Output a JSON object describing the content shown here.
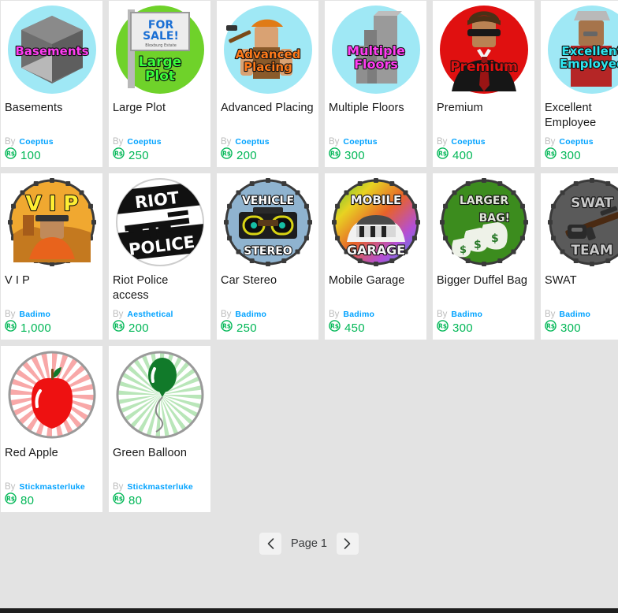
{
  "page": {
    "background_color": "#e3e3e3",
    "card_background": "#ffffff",
    "link_color": "#00a2ff",
    "price_color": "#02b757",
    "title_color": "#191919",
    "by_label": "By"
  },
  "items": [
    {
      "name": "Basements",
      "creator": "Coeptus",
      "price": "100",
      "thumb": {
        "id": "basements-thumbnail",
        "bg": "#9fe8f5",
        "art_text": "Basements",
        "art_color": "#ff3df2"
      }
    },
    {
      "name": "Large Plot",
      "creator": "Coeptus",
      "price": "250",
      "thumb": {
        "id": "large-plot-thumbnail",
        "bg": "#6fd22a",
        "art_text": "Large Plot",
        "art_color": "#3bff3b"
      }
    },
    {
      "name": "Advanced Placing",
      "creator": "Coeptus",
      "price": "200",
      "thumb": {
        "id": "advanced-placing-thumbnail",
        "bg": "#9fe8f5",
        "art_text": "Advanced Placing",
        "art_color": "#ff7a1a"
      }
    },
    {
      "name": "Multiple Floors",
      "creator": "Coeptus",
      "price": "300",
      "thumb": {
        "id": "multiple-floors-thumbnail",
        "bg": "#9fe8f5",
        "art_text": "Multiple Floors",
        "art_color": "#ff3df2"
      }
    },
    {
      "name": "Premium",
      "creator": "Coeptus",
      "price": "400",
      "thumb": {
        "id": "premium-thumbnail",
        "bg": "#e01010",
        "art_text": "Premium",
        "art_color": "#e01010"
      }
    },
    {
      "name": "Excellent Employee",
      "creator": "Coeptus",
      "price": "300",
      "thumb": {
        "id": "excellent-employee-thumbnail",
        "bg": "#9fe8f5",
        "art_text": "Excellent Employee",
        "art_color": "#2ee6f0"
      }
    },
    {
      "name": "V I P",
      "creator": "Badimo",
      "price": "1,000",
      "thumb": {
        "id": "vip-thumbnail",
        "bg": "#f0a830",
        "art_text": "VIP",
        "art_color": "#ffee33"
      }
    },
    {
      "name": "Riot Police access",
      "creator": "Aesthetical",
      "price": "200",
      "thumb": {
        "id": "riot-police-thumbnail",
        "bg": "#ffffff",
        "art_text": "RIOT POLICE",
        "art_color": "#111111"
      }
    },
    {
      "name": "Car Stereo",
      "creator": "Badimo",
      "price": "250",
      "thumb": {
        "id": "car-stereo-thumbnail",
        "bg": "#8fb3cf",
        "art_text": "VEHICLE STEREO",
        "art_color": "#ffffff"
      }
    },
    {
      "name": "Mobile Garage",
      "creator": "Badimo",
      "price": "450",
      "thumb": {
        "id": "mobile-garage-thumbnail",
        "bg": "#49b84a",
        "art_text": "MOBILE GARAGE",
        "art_color": "#111111"
      }
    },
    {
      "name": "Bigger Duffel Bag",
      "creator": "Badimo",
      "price": "300",
      "thumb": {
        "id": "bigger-duffel-bag-thumbnail",
        "bg": "#3c8c1e",
        "art_text": "LARGER BAG!",
        "art_color": "#dfe6d8"
      }
    },
    {
      "name": "SWAT",
      "creator": "Badimo",
      "price": "300",
      "thumb": {
        "id": "swat-thumbnail",
        "bg": "#5a5a5a",
        "art_text": "SWAT TEAM",
        "art_color": "#c9c9c9"
      }
    },
    {
      "name": "Red Apple",
      "creator": "Stickmasterluke",
      "price": "80",
      "thumb": {
        "id": "red-apple-thumbnail",
        "bg": "#f8a8a8",
        "art_text": "",
        "art_color": "#ee1111"
      }
    },
    {
      "name": "Green Balloon",
      "creator": "Stickmasterluke",
      "price": "80",
      "thumb": {
        "id": "green-balloon-thumbnail",
        "bg": "#b9e6b9",
        "art_text": "",
        "art_color": "#117a2a"
      }
    }
  ],
  "pagination": {
    "previous_label": "Previous page",
    "next_label": "Next page",
    "page_label": "Page 1"
  }
}
